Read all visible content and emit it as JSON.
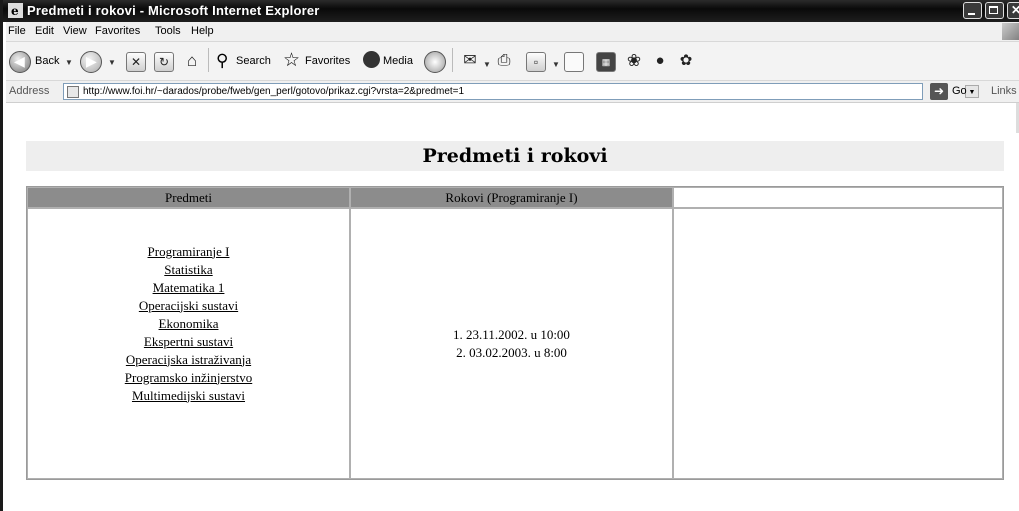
{
  "window": {
    "title": "Predmeti i rokovi - Microsoft Internet Explorer"
  },
  "menu": [
    "File",
    "Edit",
    "View",
    "Favorites",
    "Tools",
    "Help"
  ],
  "toolbar": {
    "back_label": "Back",
    "search_label": "Search",
    "favorites_label": "Favorites",
    "media_label": "Media"
  },
  "address": {
    "label": "Address",
    "url": "http://www.foi.hr/~darados/probe/fweb/gen_perl/gotovo/prikaz.cgi?vrsta=2&predmet=1",
    "go_label": "Go",
    "links_label": "Links"
  },
  "page": {
    "heading": "Predmeti i rokovi",
    "col1_header": "Predmeti",
    "col2_header": "Rokovi (Programiranje I)",
    "col3_header": "",
    "subjects": [
      "Programiranje I",
      "Statistika",
      "Matematika 1",
      "Operacijski sustavi",
      "Ekonomika",
      "Ekspertni sustavi",
      "Operacijska istraživanja",
      "Programsko inžinjerstvo",
      "Multimedijski sustavi"
    ],
    "dates": [
      "1. 23.11.2002. u 10:00",
      "2. 03.02.2003. u 8:00"
    ]
  }
}
